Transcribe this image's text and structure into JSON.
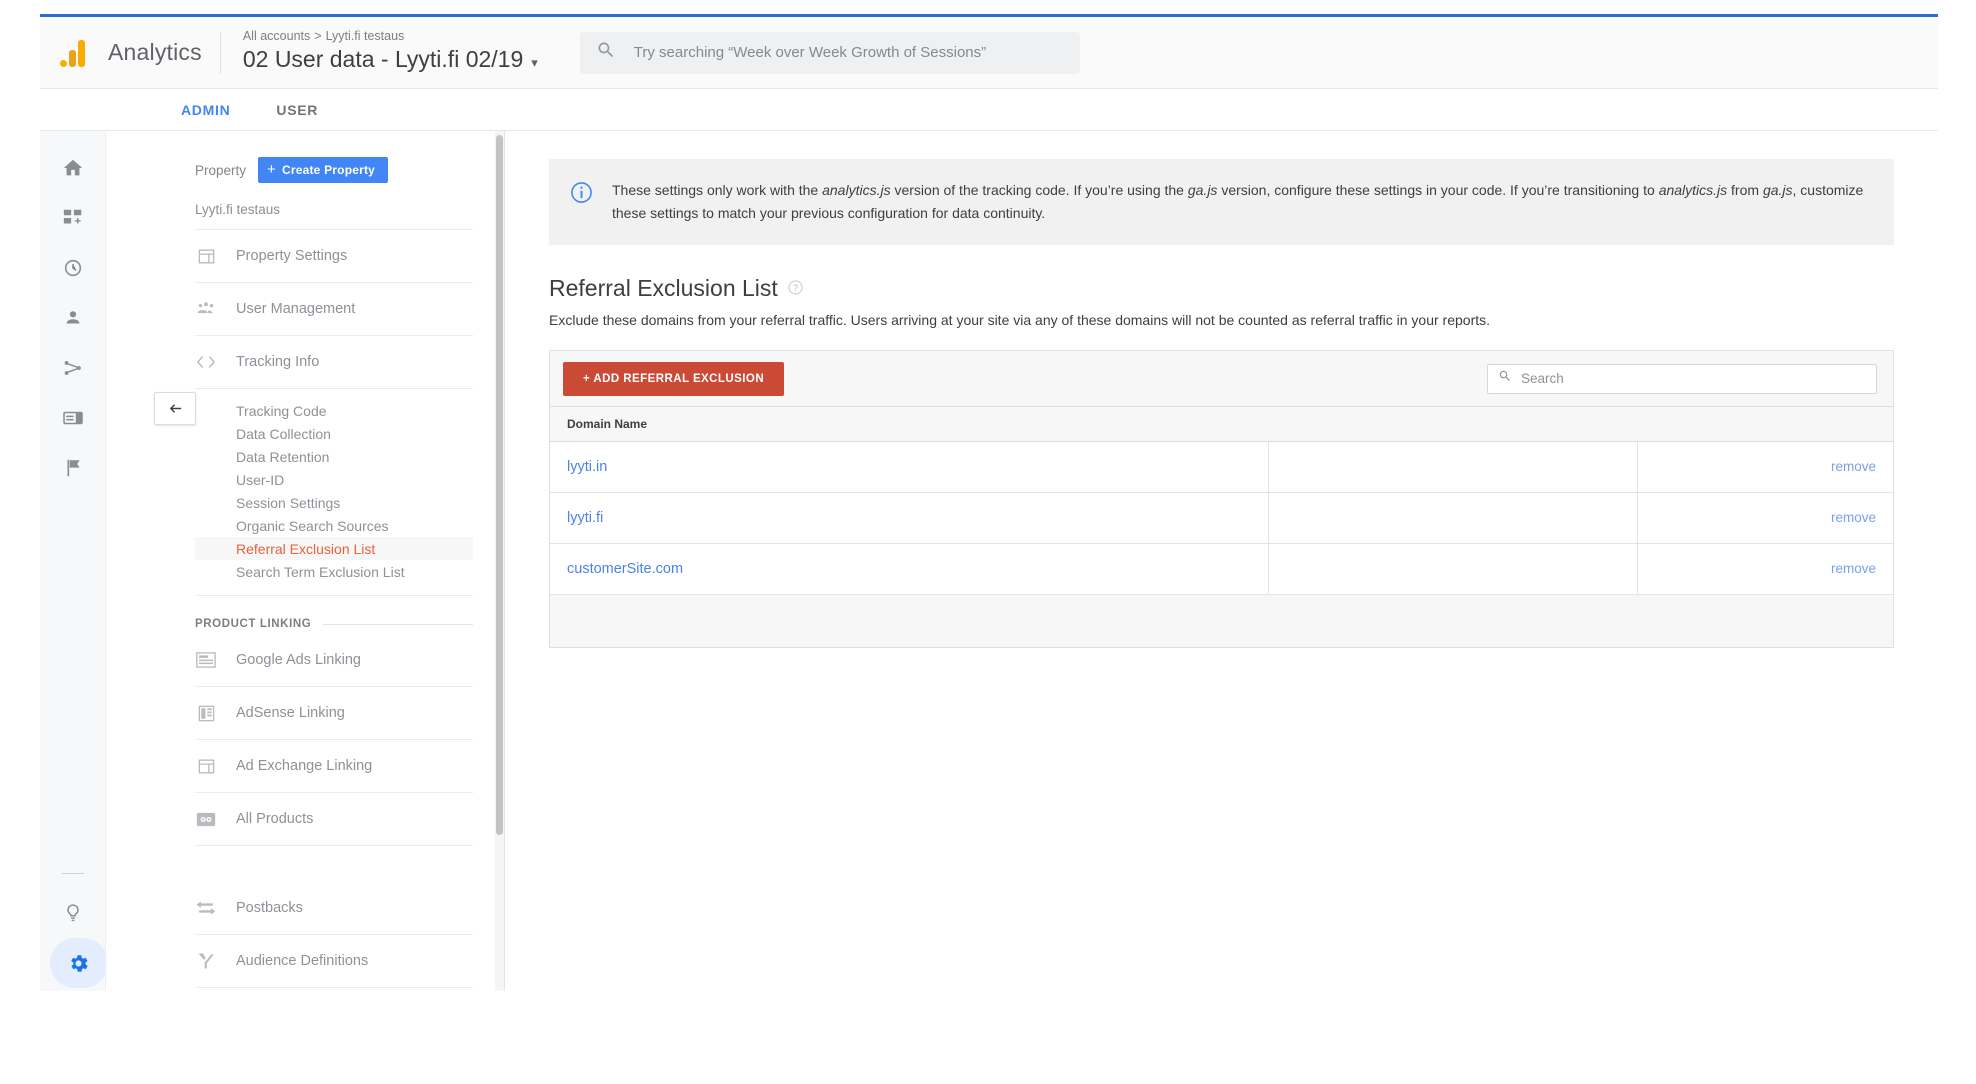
{
  "header": {
    "brand": "Analytics",
    "logo_icon": "analytics-logo-icon",
    "breadcrumb_root": "All accounts",
    "breadcrumb_sep": ">",
    "breadcrumb_account": "Lyyti.fi testaus",
    "property_title": "02 User data - Lyyti.fi 02/19",
    "caret": "▾",
    "search_icon": "search-icon",
    "search_value": "",
    "search_placeholder": "Try searching “Week over Week Growth of Sessions”"
  },
  "tabs": [
    {
      "label": "ADMIN",
      "active": true
    },
    {
      "label": "USER",
      "active": false
    }
  ],
  "rail": {
    "items": [
      {
        "icon": "home-icon",
        "name": "home"
      },
      {
        "icon": "customization-icon",
        "name": "customization"
      },
      {
        "icon": "realtime-clock-icon",
        "name": "realtime"
      },
      {
        "icon": "audience-person-icon",
        "name": "audience"
      },
      {
        "icon": "acquisition-share-icon",
        "name": "acquisition"
      },
      {
        "icon": "behavior-display-icon",
        "name": "behavior"
      },
      {
        "icon": "conversions-flag-icon",
        "name": "conversions"
      }
    ],
    "bottom": [
      {
        "icon": "discover-bulb-icon",
        "name": "discover",
        "active": false
      },
      {
        "icon": "admin-gear-icon",
        "name": "admin",
        "active": true
      }
    ]
  },
  "nav": {
    "back_icon": "back-arrow-icon",
    "property_label": "Property",
    "create_property_label": "Create Property",
    "create_property_plus": "+",
    "property_name": "Lyyti.fi testaus",
    "items": [
      {
        "label": "Property Settings",
        "icon": "property-settings-icon"
      },
      {
        "label": "User Management",
        "icon": "user-management-icon"
      },
      {
        "label": "Tracking Info",
        "icon": "code-brackets-icon"
      }
    ],
    "tracking_sub_items": [
      {
        "label": "Tracking Code",
        "selected": false
      },
      {
        "label": "Data Collection",
        "selected": false
      },
      {
        "label": "Data Retention",
        "selected": false
      },
      {
        "label": "User-ID",
        "selected": false
      },
      {
        "label": "Session Settings",
        "selected": false
      },
      {
        "label": "Organic Search Sources",
        "selected": false
      },
      {
        "label": "Referral Exclusion List",
        "selected": true
      },
      {
        "label": "Search Term Exclusion List",
        "selected": false
      }
    ],
    "product_linking_label": "PRODUCT LINKING",
    "product_items": [
      {
        "label": "Google Ads Linking",
        "icon": "google-ads-icon"
      },
      {
        "label": "AdSense Linking",
        "icon": "adsense-icon"
      },
      {
        "label": "Ad Exchange Linking",
        "icon": "ad-exchange-icon"
      },
      {
        "label": "All Products",
        "icon": "all-products-icon"
      }
    ],
    "lower_items": [
      {
        "label": "Postbacks",
        "icon": "postbacks-icon"
      },
      {
        "label": "Audience Definitions",
        "icon": "audience-definitions-icon"
      }
    ]
  },
  "main": {
    "notice_icon": "info-icon",
    "notice_parts": [
      {
        "t": "These settings only work with the ",
        "i": false
      },
      {
        "t": "analytics.js",
        "i": true
      },
      {
        "t": " version of the tracking code. If you’re using the ",
        "i": false
      },
      {
        "t": "ga.js",
        "i": true
      },
      {
        "t": " version, configure these settings in your code. If you’re transitioning to ",
        "i": false
      },
      {
        "t": "analytics.js",
        "i": true
      },
      {
        "t": " from ",
        "i": false
      },
      {
        "t": "ga.js",
        "i": true
      },
      {
        "t": ", customize these settings to match your previous configuration for data continuity.",
        "i": false
      }
    ],
    "section_title": "Referral Exclusion List",
    "help_icon": "help-circle-icon",
    "section_desc": "Exclude these domains from your referral traffic. Users arriving at your site via any of these domains will not be counted as referral traffic in your reports.",
    "add_button_label": "+ ADD REFERRAL EXCLUSION",
    "table_search_icon": "search-icon",
    "table_search_value": "",
    "table_search_placeholder": "Search",
    "table": {
      "columns": [
        "Domain Name",
        "",
        ""
      ],
      "rows": [
        {
          "domain": "lyyti.in",
          "mid": "",
          "action": "remove"
        },
        {
          "domain": "lyyti.fi",
          "mid": "",
          "action": "remove"
        },
        {
          "domain": "customerSite.com",
          "mid": "",
          "action": "remove"
        }
      ]
    }
  },
  "colors": {
    "brand_blue": "#4285f4",
    "accent_red": "#ca4a36",
    "selected_orange": "#e8623a",
    "link_blue": "#4d82e8",
    "logo_yellow": "#f9ab00"
  }
}
